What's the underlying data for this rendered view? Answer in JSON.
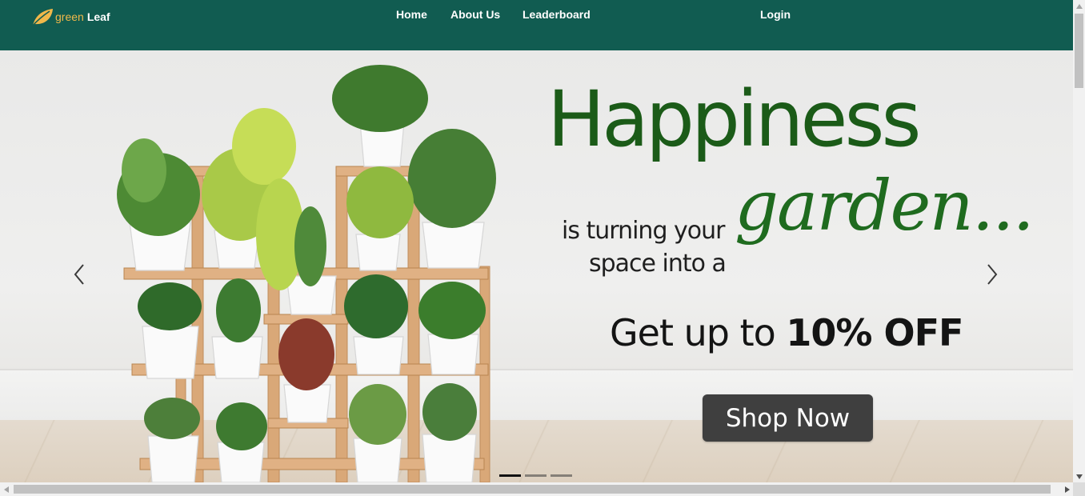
{
  "navbar": {
    "brand": {
      "word1": "green",
      "word2": "Leaf",
      "logo_icon": "leaf-icon"
    },
    "links": [
      {
        "label": "Home"
      },
      {
        "label": "About Us"
      },
      {
        "label": "Leaderboard"
      }
    ],
    "login_label": "Login",
    "colors": {
      "background": "#115c51",
      "brand_accent": "#f0b84a",
      "text": "#ffffff"
    }
  },
  "carousel": {
    "slide": {
      "headline": "Happiness",
      "subline_1": "is turning your",
      "subline_2": "space into a",
      "script_word": "garden...",
      "offer_prefix": "Get up to ",
      "offer_bold": "10% OFF",
      "cta_label": "Shop Now",
      "image_subject": "potted plants on a wooden tiered stand",
      "colors": {
        "headline": "#1b5b18",
        "script": "#1f6b1f",
        "cta_bg": "#3f3f3f"
      }
    },
    "prev_icon": "chevron-left-icon",
    "next_icon": "chevron-right-icon",
    "indicator_count": 3,
    "active_indicator": 1
  },
  "scrollbars": {
    "vertical_icons": [
      "arrow-up-icon",
      "arrow-down-icon"
    ],
    "horizontal_icons": [
      "arrow-left-icon",
      "arrow-right-icon"
    ]
  }
}
